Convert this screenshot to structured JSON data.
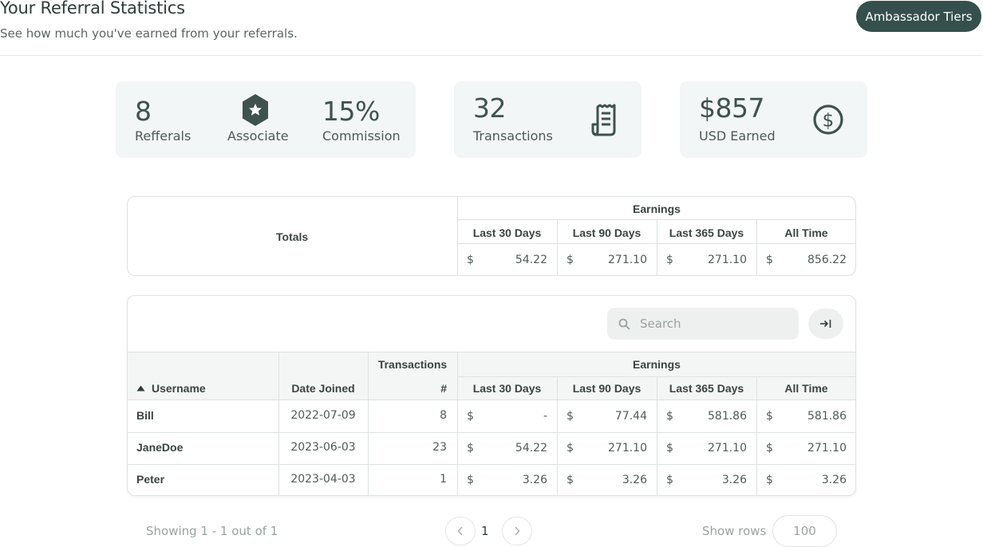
{
  "header": {
    "title": "Your Referral Statistics",
    "subtitle": "See how much you've earned from your referrals.",
    "tiers_button": "Ambassador Tiers"
  },
  "stats": {
    "referrals_value": "8",
    "referrals_label": "Refferals",
    "tier_label": "Associate",
    "commission_value": "15%",
    "commission_label": "Commission",
    "transactions_value": "32",
    "transactions_label": "Transactions",
    "earned_value": "$857",
    "earned_label": "USD Earned"
  },
  "totals": {
    "label": "Totals",
    "group_header": "Earnings",
    "columns": [
      "Last 30 Days",
      "Last 90 Days",
      "Last 365 Days",
      "All Time"
    ],
    "currency": "$",
    "values": [
      "54.22",
      "271.10",
      "271.10",
      "856.22"
    ]
  },
  "table": {
    "search_placeholder": "Search",
    "headers": {
      "username": "Username",
      "date_joined": "Date Joined",
      "transactions": "Transactions",
      "transactions_sub": "#",
      "earnings": "Earnings",
      "last30": "Last 30 Days",
      "last90": "Last 90 Days",
      "last365": "Last 365 Days",
      "all_time": "All Time"
    },
    "currency": "$",
    "rows": [
      {
        "username": "Bill",
        "date": "2022-07-09",
        "tx": "8",
        "l30": "-",
        "l90": "77.44",
        "l365": "581.86",
        "all": "581.86"
      },
      {
        "username": "JaneDoe",
        "date": "2023-06-03",
        "tx": "23",
        "l30": "54.22",
        "l90": "271.10",
        "l365": "271.10",
        "all": "271.10"
      },
      {
        "username": "Peter",
        "date": "2023-04-03",
        "tx": "1",
        "l30": "3.26",
        "l90": "3.26",
        "l365": "3.26",
        "all": "3.26"
      }
    ]
  },
  "footer": {
    "showing": "Showing 1 - 1 out of 1",
    "page": "1",
    "show_rows_label": "Show rows",
    "rows_value": "100"
  },
  "colors": {
    "accent": "#35504c",
    "card_bg": "#f3f6f6",
    "border": "#dde2e1"
  },
  "icons": {
    "tier": "hexagon-star-icon",
    "transactions": "receipt-icon",
    "earned": "dollar-circle-icon",
    "search": "search-icon",
    "export": "export-icon",
    "sort": "sort-asc-icon"
  }
}
